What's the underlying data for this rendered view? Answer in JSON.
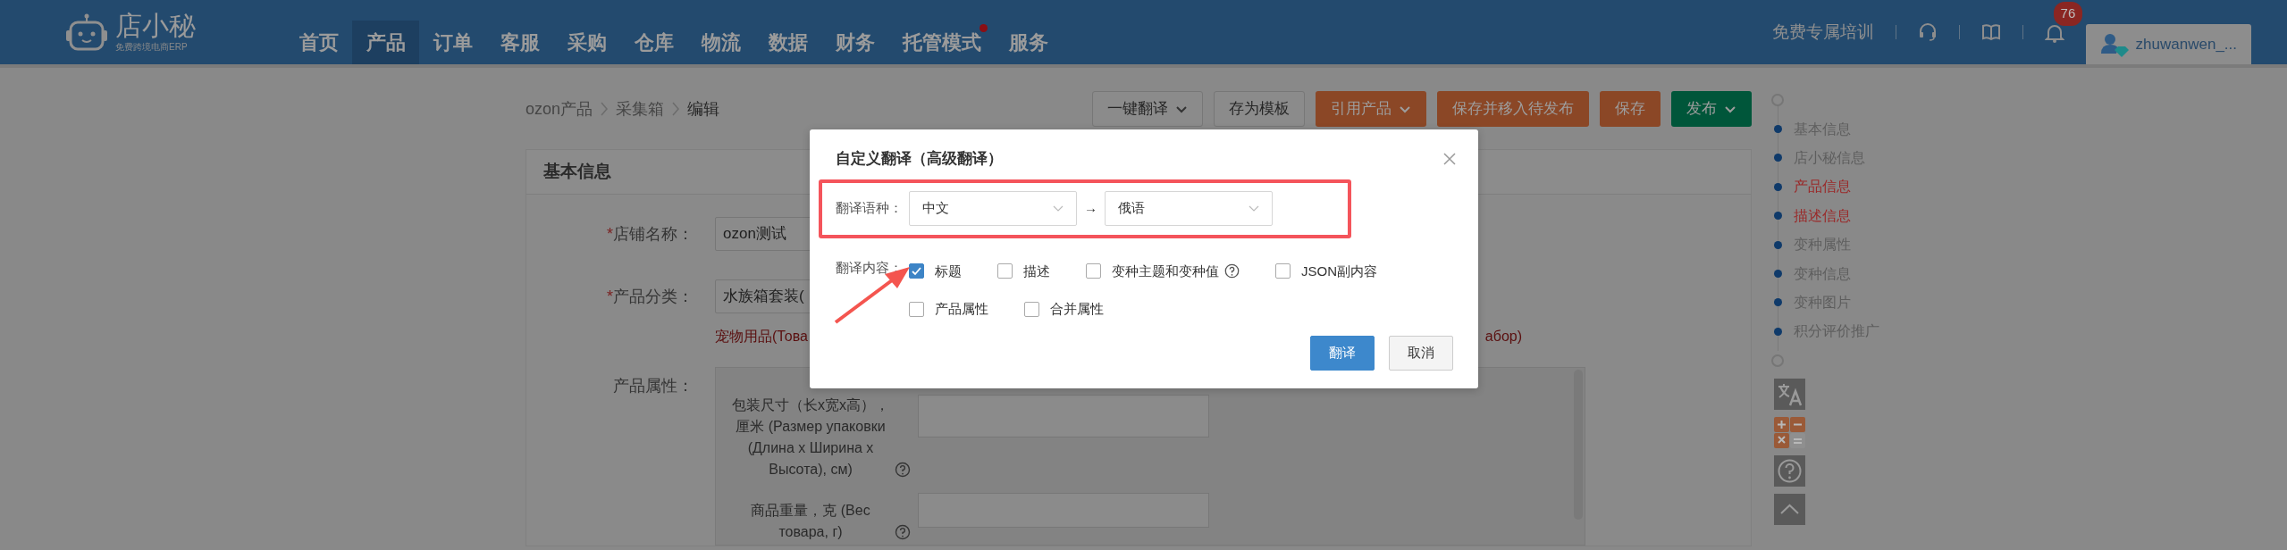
{
  "app": {
    "logo_text": "店小秘",
    "logo_subtitle": "免费跨境电商ERP"
  },
  "nav": [
    {
      "label": "首页",
      "selected": false,
      "dot": false
    },
    {
      "label": "产品",
      "selected": true,
      "dot": false
    },
    {
      "label": "订单",
      "selected": false,
      "dot": false
    },
    {
      "label": "客服",
      "selected": false,
      "dot": false
    },
    {
      "label": "采购",
      "selected": false,
      "dot": false
    },
    {
      "label": "仓库",
      "selected": false,
      "dot": false
    },
    {
      "label": "物流",
      "selected": false,
      "dot": false
    },
    {
      "label": "数据",
      "selected": false,
      "dot": false
    },
    {
      "label": "财务",
      "selected": false,
      "dot": false
    },
    {
      "label": "托管模式",
      "selected": false,
      "dot": true
    },
    {
      "label": "服务",
      "selected": false,
      "dot": false
    }
  ],
  "header_right": {
    "training_link": "免费专属培训",
    "notification_count": "76",
    "username": "zhuwanwen_..."
  },
  "breadcrumb": [
    {
      "label": "ozon产品",
      "current": false
    },
    {
      "label": "采集箱",
      "current": false
    },
    {
      "label": "编辑",
      "current": true
    }
  ],
  "toolbar": [
    {
      "label": "一键翻译",
      "kind": "default",
      "dropdown": true
    },
    {
      "label": "存为模板",
      "kind": "default",
      "dropdown": false
    },
    {
      "label": "引用产品",
      "kind": "warning",
      "dropdown": true
    },
    {
      "label": "保存并移入待发布",
      "kind": "warning",
      "dropdown": false
    },
    {
      "label": "保存",
      "kind": "warning",
      "dropdown": false
    },
    {
      "label": "发布",
      "kind": "success",
      "dropdown": true
    }
  ],
  "section": {
    "title": "基本信息",
    "fields": [
      {
        "kind": "input",
        "required_mark": "*",
        "label": "店铺名称：",
        "value": "ozon测试"
      },
      {
        "kind": "select",
        "required_mark": "*",
        "label": "产品分类：",
        "value": "水族箱套装(",
        "category_path_start": "宠物用品(Това",
        "category_path_end": "абор)"
      },
      {
        "kind": "attributes",
        "label": "产品属性：",
        "attributes": [
          {
            "label": "包装尺寸（长x宽x高），厘米 (Размер упаковки (Длина x Ширина x Высота), см)",
            "help": true
          },
          {
            "label": "商品重量，克 (Вес товара, г)",
            "help": true
          }
        ]
      }
    ]
  },
  "anchor_nav": [
    {
      "label": "基本信息",
      "highlighted": false
    },
    {
      "label": "店小秘信息",
      "highlighted": false
    },
    {
      "label": "产品信息",
      "highlighted": true
    },
    {
      "label": "描述信息",
      "highlighted": true
    },
    {
      "label": "变种属性",
      "highlighted": false
    },
    {
      "label": "变种信息",
      "highlighted": false
    },
    {
      "label": "变种图片",
      "highlighted": false
    },
    {
      "label": "积分评价推广",
      "highlighted": false
    }
  ],
  "dialog": {
    "title": "自定义翻译（高级翻译）",
    "highlight_box": true,
    "pointer_arrow": true,
    "language_label": "翻译语种：",
    "source_language": "中文",
    "arrow": "→",
    "target_language": "俄语",
    "content_label": "翻译内容：",
    "option_rows": [
      {
        "options": [
          {
            "label": "标题",
            "checked": true,
            "help": false
          },
          {
            "label": "描述",
            "checked": false,
            "help": false
          },
          {
            "label": "变种主题和变种值",
            "checked": false,
            "help": true
          },
          {
            "label": "JSON副内容",
            "checked": false,
            "help": false
          }
        ]
      },
      {
        "options": [
          {
            "label": "产品属性",
            "checked": false,
            "help": false
          },
          {
            "label": "合并属性",
            "checked": false,
            "help": false
          }
        ]
      }
    ],
    "buttons": [
      {
        "label": "翻译",
        "kind": "primary"
      },
      {
        "label": "取消",
        "kind": "secondary"
      }
    ]
  }
}
